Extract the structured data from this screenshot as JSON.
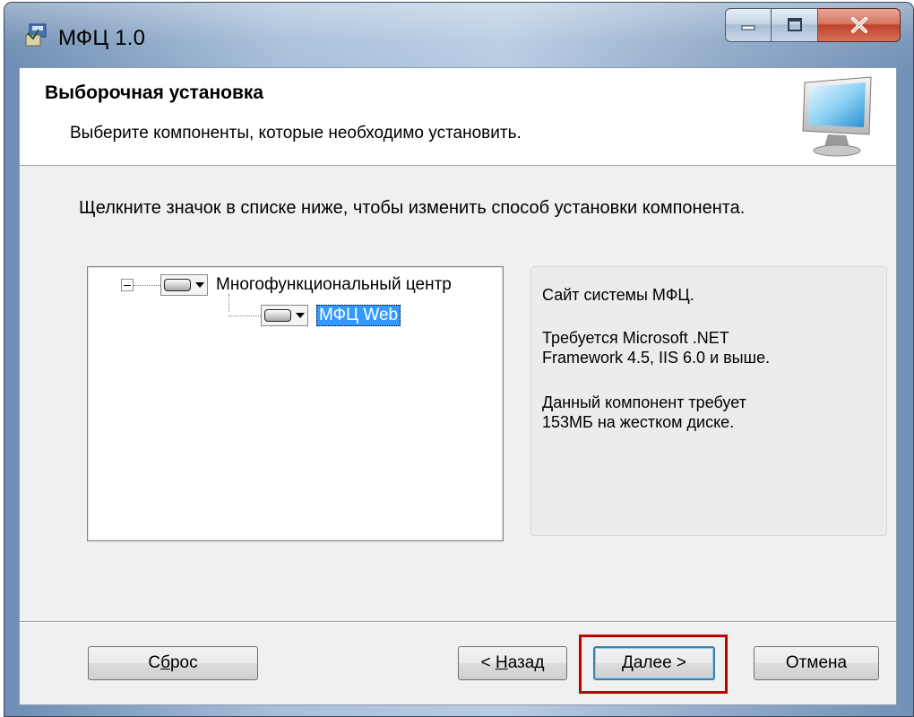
{
  "window": {
    "title": "МФЦ 1.0",
    "icons": {
      "app": "installer-icon",
      "minimize": "minimize-icon",
      "maximize": "maximize-icon",
      "close": "close-icon"
    }
  },
  "banner": {
    "title": "Выборочная установка",
    "subtitle": "Выберите компоненты, которые необходимо установить.",
    "icon": "monitor-icon"
  },
  "instruction": "Щелкните значок в списке ниже, чтобы изменить способ установки компонента.",
  "tree": {
    "items": [
      {
        "label": "Многофункциональный центр",
        "expanded": true,
        "icon": "drive-icon",
        "selected": false
      },
      {
        "label": "МФЦ Web",
        "icon": "drive-icon",
        "selected": true
      }
    ]
  },
  "description": {
    "line1": "Сайт системы МФЦ.",
    "line2": "Требуется Microsoft .NET",
    "line3": "Framework 4.5, IIS 6.0 и выше.",
    "line4": "Данный компонент требует",
    "line5": "153МБ на жестком диске."
  },
  "buttons": {
    "reset": {
      "before": "С",
      "accel": "б",
      "after": "рос"
    },
    "back": {
      "before": "< ",
      "accel": "Н",
      "after": "азад"
    },
    "next": {
      "before": "",
      "accel": "Д",
      "after": "алее >"
    },
    "cancel": "Отмена"
  },
  "colors": {
    "highlight": "#c00000",
    "selection": "#3399ff",
    "window_frame": "#a7bfd9"
  }
}
